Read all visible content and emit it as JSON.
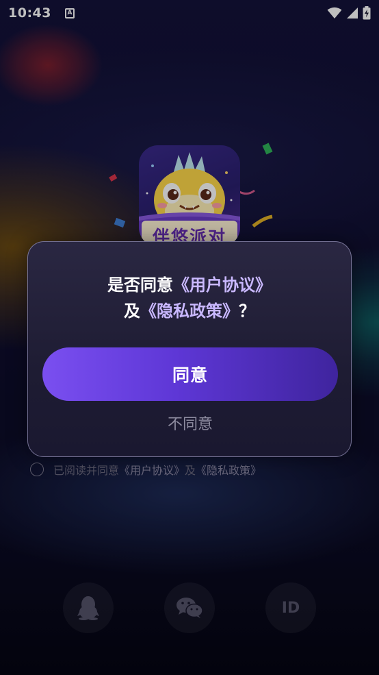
{
  "status_bar": {
    "time": "10:43",
    "notification_icon_letter": "A",
    "icons": [
      "wifi-icon",
      "signal-icon",
      "battery-charging-icon"
    ]
  },
  "app": {
    "logo_text": "伴悠派对"
  },
  "agreement": {
    "prefix": "已阅读并同意",
    "user_agreement": "《用户协议》",
    "and": "及",
    "privacy_policy": "《隐私政策》"
  },
  "login_options": [
    {
      "name": "qq",
      "icon": "qq-penguin-icon"
    },
    {
      "name": "wechat",
      "icon": "wechat-icon"
    },
    {
      "name": "id",
      "label": "ID"
    }
  ],
  "dialog": {
    "title_prefix": "是否同意",
    "title_user_agreement": "《用户协议》",
    "title_and": "及",
    "title_privacy_policy": "《隐私政策》",
    "title_suffix": "？",
    "agree_label": "同意",
    "disagree_label": "不同意"
  },
  "colors": {
    "accent_start": "#7a4ff0",
    "accent_end": "#3f249e",
    "link": "#c9b8ff",
    "muted_text": "#8e8ca0"
  }
}
